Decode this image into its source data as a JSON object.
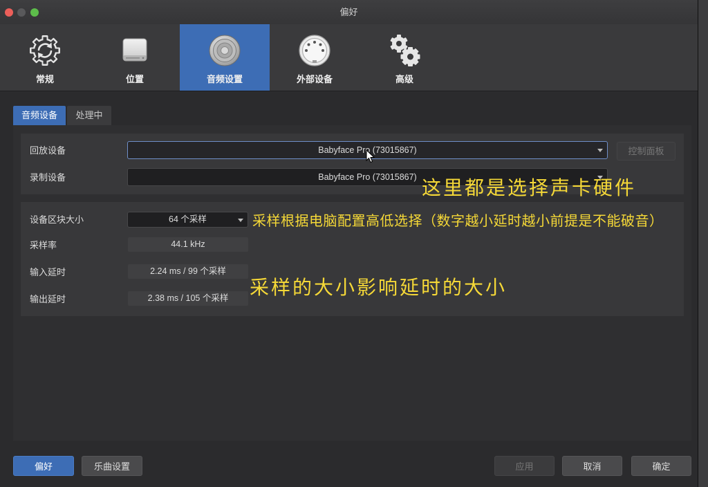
{
  "window": {
    "title": "偏好"
  },
  "toolbar": {
    "selected": "音频设置",
    "tabs": [
      {
        "label": "常规",
        "icon": "gear-sync-icon"
      },
      {
        "label": "位置",
        "icon": "drive-icon"
      },
      {
        "label": "音频设置",
        "icon": "speaker-icon"
      },
      {
        "label": "外部设备",
        "icon": "midi-connector-icon"
      },
      {
        "label": "高级",
        "icon": "gears-icon"
      }
    ]
  },
  "subtabs": [
    {
      "label": "音频设备",
      "selected": true
    },
    {
      "label": "处理中",
      "selected": false
    }
  ],
  "device_section": {
    "playback": {
      "label": "回放设备",
      "value": "Babyface Pro (73015867)"
    },
    "recording": {
      "label": "录制设备",
      "value": "Babyface Pro (73015867)"
    },
    "control_panel_label": "控制面板"
  },
  "buffer_section": {
    "block_size": {
      "label": "设备区块大小",
      "value": "64 个采样"
    },
    "sample_rate": {
      "label": "采样率",
      "value": "44.1 kHz"
    },
    "input_latency": {
      "label": "输入延时",
      "value": "2.24 ms / 99 个采样"
    },
    "output_latency": {
      "label": "输出延时",
      "value": "2.38 ms / 105 个采样"
    }
  },
  "annotations": [
    "这里都是选择声卡硬件",
    "采样根据电脑配置高低选择（数字越小延时越小前提是不能破音）",
    "采样的大小影响延时的大小"
  ],
  "footer": {
    "preferences": "偏好",
    "song_settings": "乐曲设置",
    "apply": "应用",
    "cancel": "取消",
    "ok": "确定"
  },
  "colors": {
    "accent": "#3d6db5",
    "annotation": "#f5d837",
    "window_bg": "#2b2b2d"
  }
}
